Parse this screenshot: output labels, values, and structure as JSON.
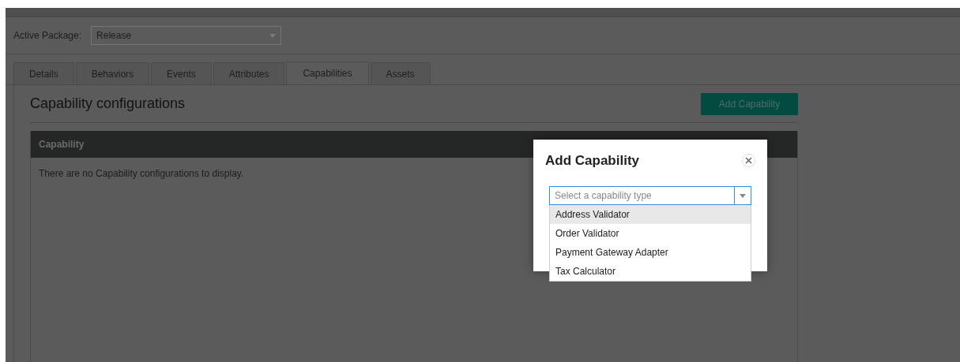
{
  "package": {
    "label": "Active Package:",
    "value": "Release"
  },
  "tabs": [
    {
      "label": "Details",
      "selected": false
    },
    {
      "label": "Behaviors",
      "selected": false
    },
    {
      "label": "Events",
      "selected": false
    },
    {
      "label": "Attributes",
      "selected": false
    },
    {
      "label": "Capabilities",
      "selected": true
    },
    {
      "label": "Assets",
      "selected": false
    }
  ],
  "section": {
    "title": "Capability configurations",
    "add_button": "Add Capability"
  },
  "table": {
    "columns": [
      "Capability"
    ],
    "empty_message": "There are no Capability configurations to display."
  },
  "dialog": {
    "title": "Add Capability",
    "select": {
      "placeholder": "Select a capability type",
      "open": true
    },
    "options": [
      {
        "label": "Address Validator",
        "selected": true
      },
      {
        "label": "Order Validator",
        "selected": false
      },
      {
        "label": "Payment Gateway Adapter",
        "selected": false
      },
      {
        "label": "Tax Calculator",
        "selected": false
      }
    ]
  }
}
